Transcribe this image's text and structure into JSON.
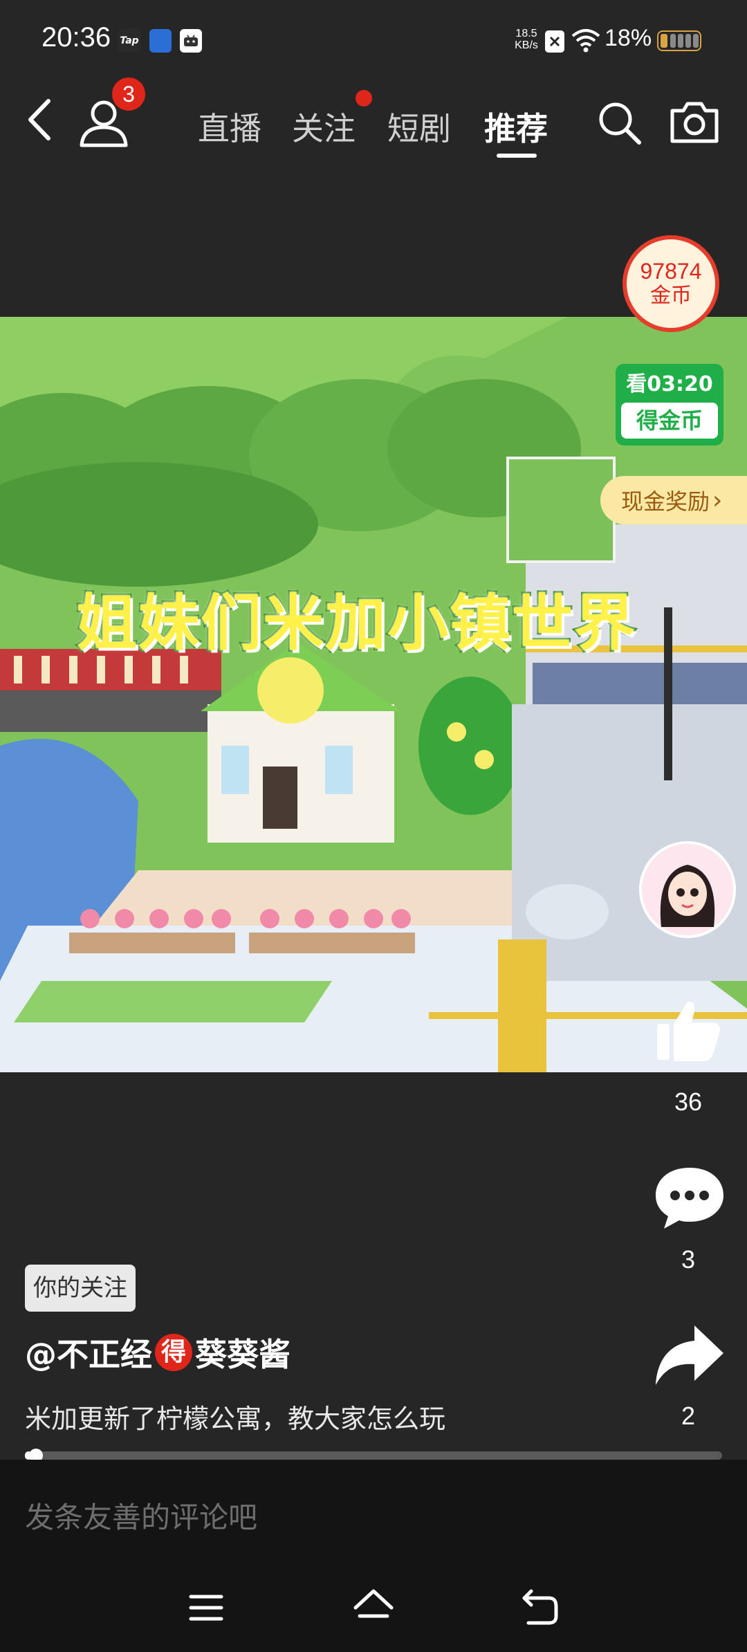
{
  "status_bar": {
    "time": "20:36",
    "app_icons": [
      "Tap"
    ],
    "net_speed_value": "18.5",
    "net_speed_unit": "KB/s",
    "battery_percent": "18%"
  },
  "top_nav": {
    "profile_badge": "3",
    "tabs": [
      {
        "label": "直播"
      },
      {
        "label": "关注"
      },
      {
        "label": "短剧"
      },
      {
        "label": "推荐"
      }
    ]
  },
  "video": {
    "overlay_title": "姐妹们米加小镇世界"
  },
  "coin_widget": {
    "amount": "97874",
    "unit": "金币",
    "watch_label": "看03:20",
    "earn_label": "得金币"
  },
  "cash_reward": {
    "label": "现金奖励",
    "chevron": "›"
  },
  "actions": {
    "likes": "36",
    "comments": "3",
    "shares": "2"
  },
  "post": {
    "follow_tag": "你的关注",
    "author_prefix": "@不正经",
    "author_badge": "得",
    "author_suffix": "葵葵酱",
    "caption": "米加更新了柠檬公寓，教大家怎么玩",
    "progress": 0.01
  },
  "comment_input": {
    "placeholder": "发条友善的评论吧"
  },
  "colors": {
    "background": "#262626",
    "accent_red": "#e0251b",
    "coin_green": "#1fae48"
  }
}
